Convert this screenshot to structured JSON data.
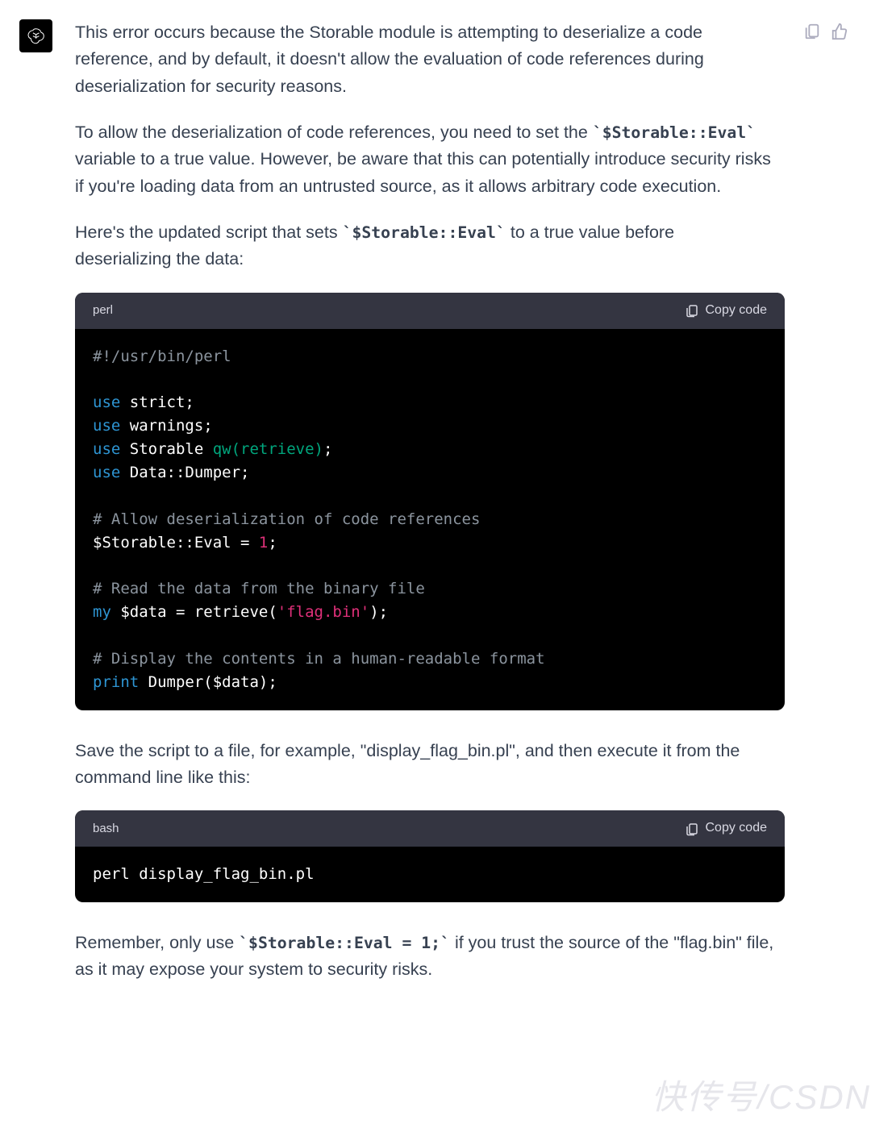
{
  "message": {
    "para1": "This error occurs because the Storable module is attempting to deserialize a code reference, and by default, it doesn't allow the evaluation of code references during deserialization for security reasons.",
    "para2_pre": "To allow the deserialization of code references, you need to set the ",
    "para2_code": "`$Storable::Eval`",
    "para2_post": " variable to a true value. However, be aware that this can potentially introduce security risks if you're loading data from an untrusted source, as it allows arbitrary code execution.",
    "para3_pre": "Here's the updated script that sets ",
    "para3_code": "`$Storable::Eval`",
    "para3_post": " to a true value before deserializing the data:",
    "para4": "Save the script to a file, for example, \"display_flag_bin.pl\", and then execute it from the command line like this:",
    "para5_pre": "Remember, only use ",
    "para5_code": "`$Storable::Eval = 1;`",
    "para5_post": " if you trust the source of the \"flag.bin\" file, as it may expose your system to security risks."
  },
  "code_block_1": {
    "lang": "perl",
    "copy_label": "Copy code",
    "tokens": [
      [
        [
          "cmt",
          "#!/usr/bin/perl"
        ]
      ],
      [],
      [
        [
          "kw",
          "use"
        ],
        [
          "txt",
          " strict;"
        ]
      ],
      [
        [
          "kw",
          "use"
        ],
        [
          "txt",
          " warnings;"
        ]
      ],
      [
        [
          "kw",
          "use"
        ],
        [
          "txt",
          " Storable "
        ],
        [
          "fn",
          "qw(retrieve)"
        ],
        [
          "txt",
          ";"
        ]
      ],
      [
        [
          "kw",
          "use"
        ],
        [
          "txt",
          " Data::Dumper;"
        ]
      ],
      [],
      [
        [
          "cmt",
          "# Allow deserialization of code references"
        ]
      ],
      [
        [
          "txt",
          "$Storable::Eval = "
        ],
        [
          "num",
          "1"
        ],
        [
          "txt",
          ";"
        ]
      ],
      [],
      [
        [
          "cmt",
          "# Read the data from the binary file"
        ]
      ],
      [
        [
          "kw",
          "my"
        ],
        [
          "txt",
          " $data = retrieve("
        ],
        [
          "str",
          "'flag.bin'"
        ],
        [
          "txt",
          ");"
        ]
      ],
      [],
      [
        [
          "cmt",
          "# Display the contents in a human-readable format"
        ]
      ],
      [
        [
          "kw",
          "print"
        ],
        [
          "txt",
          " Dumper($data);"
        ]
      ]
    ]
  },
  "code_block_2": {
    "lang": "bash",
    "copy_label": "Copy code",
    "tokens": [
      [
        [
          "txt",
          "perl display_flag_bin.pl"
        ]
      ]
    ]
  },
  "watermark": "快传号/CSDN",
  "icons": {
    "assistant": "assistant-logo",
    "clipboard": "clipboard-icon",
    "thumbs_up": "thumbs-up-icon"
  }
}
